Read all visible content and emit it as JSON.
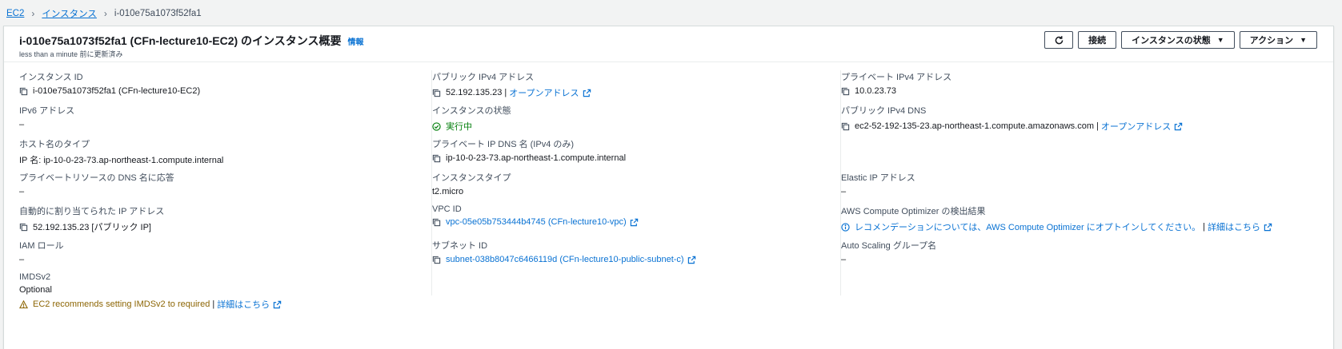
{
  "breadcrumb": {
    "ec2": "EC2",
    "instances": "インスタンス",
    "current": "i-010e75a1073f52fa1"
  },
  "header": {
    "title": "i-010e75a1073f52fa1 (CFn-lecture10-EC2) のインスタンス概要",
    "info": "情報",
    "subtitle": "less than a minute 前に更新済み",
    "connect": "接続",
    "instance_state": "インスタンスの状態",
    "actions": "アクション"
  },
  "col1": {
    "instance_id_label": "インスタンス ID",
    "instance_id": "i-010e75a1073f52fa1 (CFn-lecture10-EC2)",
    "ipv6_label": "IPv6 アドレス",
    "ipv6": "–",
    "hostname_type_label": "ホスト名のタイプ",
    "hostname_type": "IP 名: ip-10-0-23-73.ap-northeast-1.compute.internal",
    "private_dns_answer_label": "プライベートリソースの DNS 名に応答",
    "private_dns_answer": "–",
    "auto_ip_label": "自動的に割り当てられた IP アドレス",
    "auto_ip": "52.192.135.23 [パブリック IP]",
    "iam_label": "IAM ロール",
    "iam": "–",
    "imds_label": "IMDSv2",
    "imds": "Optional",
    "imds_warning": "EC2 recommends setting IMDSv2 to required",
    "imds_more": "詳細はこちら"
  },
  "col2": {
    "public_ipv4_label": "パブリック IPv4 アドレス",
    "public_ipv4": "52.192.135.23",
    "open_address": "オープンアドレス",
    "state_label": "インスタンスの状態",
    "state": "実行中",
    "private_dns_label": "プライベート IP DNS 名 (IPv4 のみ)",
    "private_dns": "ip-10-0-23-73.ap-northeast-1.compute.internal",
    "type_label": "インスタンスタイプ",
    "type": "t2.micro",
    "vpc_label": "VPC ID",
    "vpc": "vpc-05e05b753444b4745 (CFn-lecture10-vpc)",
    "subnet_label": "サブネット ID",
    "subnet": "subnet-038b8047c6466119d (CFn-lecture10-public-subnet-c)"
  },
  "col3": {
    "private_ipv4_label": "プライベート IPv4 アドレス",
    "private_ipv4": "10.0.23.73",
    "public_dns_label": "パブリック IPv4 DNS",
    "public_dns": "ec2-52-192-135-23.ap-northeast-1.compute.amazonaws.com",
    "open_address": "オープンアドレス",
    "eip_label": "Elastic IP アドレス",
    "eip": "–",
    "optimizer_label": "AWS Compute Optimizer の検出結果",
    "optimizer": "レコメンデーションについては、AWS Compute Optimizer にオプトインしてください。",
    "optimizer_more": "詳細はこちら",
    "asg_label": "Auto Scaling グループ名",
    "asg": "–"
  },
  "colors": {
    "link": "#0972d3",
    "success": "#037f0c",
    "warning": "#8d6605"
  }
}
